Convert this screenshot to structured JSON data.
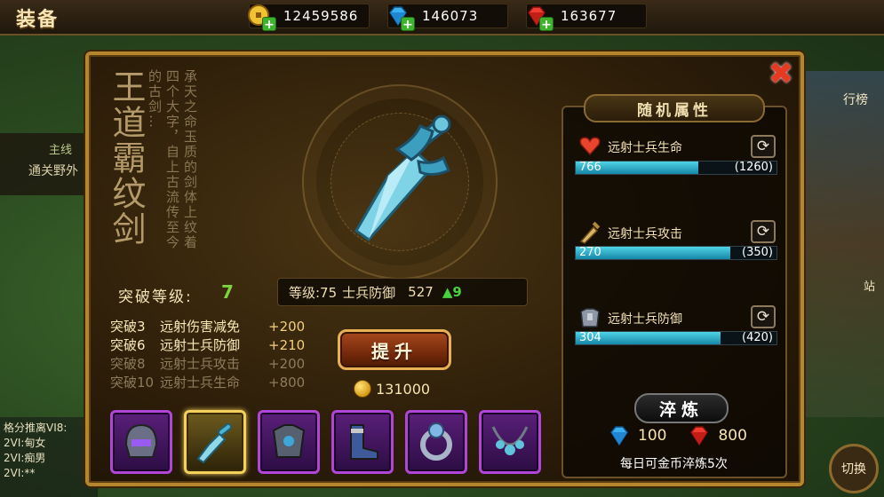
{
  "header": {
    "title": "装备"
  },
  "currencies": [
    {
      "icon": "gold-coin-icon",
      "value": "12459586"
    },
    {
      "icon": "blue-diamond-icon",
      "value": "146073"
    },
    {
      "icon": "red-ruby-icon",
      "value": "163677"
    }
  ],
  "background": {
    "left_tag": "主线",
    "left_text": "通关野外",
    "chat_lines": [
      "格分推离VI8:",
      "2VI:甸女",
      "2VI:痴男",
      "2VI:**"
    ],
    "right_text": "行榜",
    "right_road": "站",
    "switch_label": "切换"
  },
  "item": {
    "name": "王道霸纹剑",
    "description": "承天之命玉质的剑体上纹着四个大字，自上古流传至今的古剑…",
    "breakthrough_label": "突破等级:",
    "breakthrough_level": "7",
    "stats": {
      "level_text": "等级:75",
      "stat_name": "士兵防御",
      "stat_value": "527",
      "up_value": "9"
    },
    "bonuses": [
      {
        "level": "突破3",
        "name": "远射伤害减免",
        "value": "+200",
        "active": true
      },
      {
        "level": "突破6",
        "name": "远射士兵防御",
        "value": "+210",
        "active": true
      },
      {
        "level": "突破8",
        "name": "远射士兵攻击",
        "value": "+200",
        "active": false
      },
      {
        "level": "突破10",
        "name": "远射士兵生命",
        "value": "+800",
        "active": false
      }
    ],
    "upgrade_label": "提升",
    "upgrade_cost": "131000"
  },
  "random_attrs": {
    "title": "随机属性",
    "items": [
      {
        "icon": "heart-icon",
        "label": "远射士兵生命",
        "value": "766",
        "max": "(1260)",
        "fill": 0.61
      },
      {
        "icon": "sword-attack-icon",
        "label": "远射士兵攻击",
        "value": "270",
        "max": "(350)",
        "fill": 0.77
      },
      {
        "icon": "armor-icon",
        "label": "远射士兵防御",
        "value": "304",
        "max": "(420)",
        "fill": 0.72
      }
    ],
    "refine_label": "淬炼",
    "refine_cost_diamond": "100",
    "refine_cost_ruby": "800",
    "refine_note": "每日可金币淬炼5次"
  },
  "equipment_slots": [
    {
      "icon": "helmet-icon",
      "selected": false
    },
    {
      "icon": "sword-icon",
      "selected": true
    },
    {
      "icon": "chest-armor-icon",
      "selected": false
    },
    {
      "icon": "boots-icon",
      "selected": false
    },
    {
      "icon": "ring-icon",
      "selected": false
    },
    {
      "icon": "necklace-icon",
      "selected": false
    }
  ],
  "colors": {
    "frame_gold": "#b5862e",
    "active_green": "#7bd63b",
    "bar_cyan": "#4fd4e6",
    "slot_purple": "#b046d8",
    "close_red": "#e63a23"
  }
}
